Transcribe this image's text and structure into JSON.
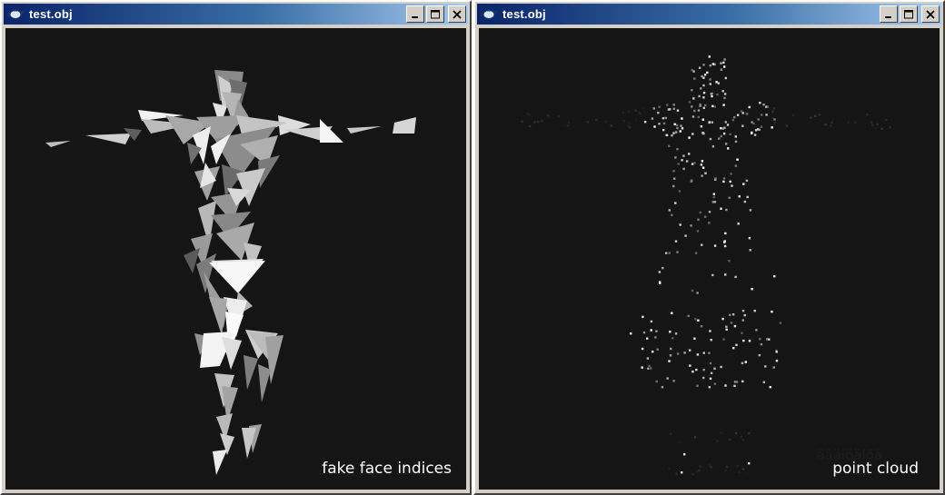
{
  "windows": [
    {
      "title": "test.obj",
      "app_icon": "teapot-icon",
      "controls": [
        "minimize-icon",
        "maximize-icon",
        "close-icon"
      ],
      "overlay_label": "fake face indices"
    },
    {
      "title": "test.obj",
      "app_icon": "teapot-icon",
      "controls": [
        "minimize-icon",
        "maximize-icon",
        "close-icon"
      ],
      "overlay_label": "point cloud",
      "overlay_garbled": "ääälöälöä"
    }
  ],
  "colors": {
    "viewport_background": "#151515",
    "titlebar_start": "#0a246a",
    "titlebar_end": "#a6caf0",
    "window_chrome": "#d4d0c8"
  }
}
